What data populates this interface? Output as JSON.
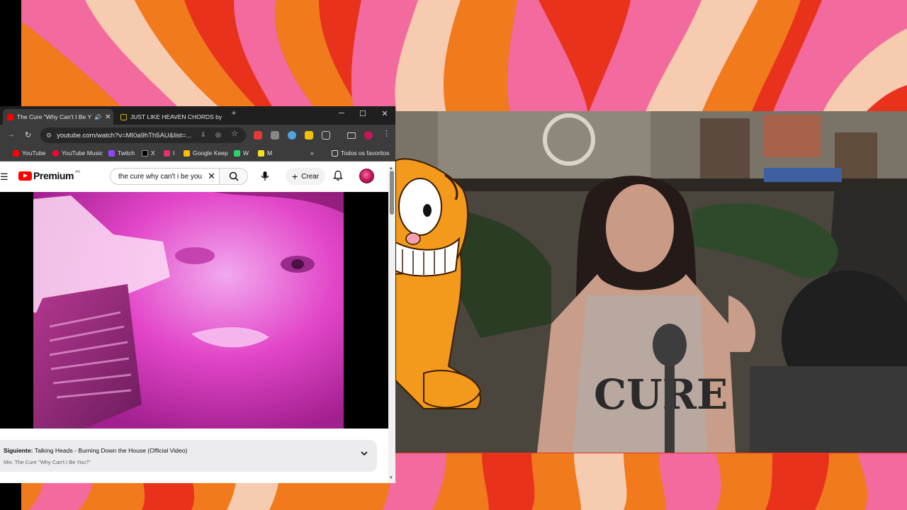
{
  "browser": {
    "tabs": [
      {
        "title": "The Cure \"Why Can't I Be Y",
        "active": true,
        "icon": "youtube-favicon",
        "audio": true
      },
      {
        "title": "JUST LIKE HEAVEN CHORDS by",
        "active": false,
        "icon": "chords-favicon"
      }
    ],
    "new_tab": "+",
    "window_controls": {
      "minimize": "─",
      "maximize": "☐",
      "close": "✕"
    },
    "url": "youtube.com/watch?v=MI0a9hTh5AU&list=...",
    "bookmarks": [
      {
        "label": "YouTube",
        "color": "#ff0000"
      },
      {
        "label": "YouTube Music",
        "color": "#ff0033"
      },
      {
        "label": "Twitch",
        "color": "#9146ff"
      },
      {
        "label": "X",
        "color": "#000000"
      },
      {
        "label": "I",
        "color": "#e1306c"
      },
      {
        "label": "Google Keep",
        "color": "#fbbc04"
      },
      {
        "label": "W",
        "color": "#2bd46a"
      },
      {
        "label": "M",
        "color": "#f7e01d"
      }
    ],
    "bookmarks_overflow": "»",
    "all_bookmarks": "Todos os favoritos"
  },
  "youtube": {
    "logo_text": "Premium",
    "logo_sup": "AR",
    "search_query": "the cure why can't i be you",
    "create_label": "Crear",
    "next_label": "Siguiente:",
    "next_title": "Talking Heads - Burning Down the House (Official Video)",
    "mix_label": "Mix: The Cure \"Why Can't I Be You?\""
  },
  "colors": {
    "yt_red": "#ff0000",
    "bg_red": "#e8321c",
    "bg_orange": "#f07a1c",
    "bg_pink": "#f26a9e",
    "bg_cream": "#f6cbb0"
  },
  "overlay": {
    "character": "garfield-cartoon"
  }
}
